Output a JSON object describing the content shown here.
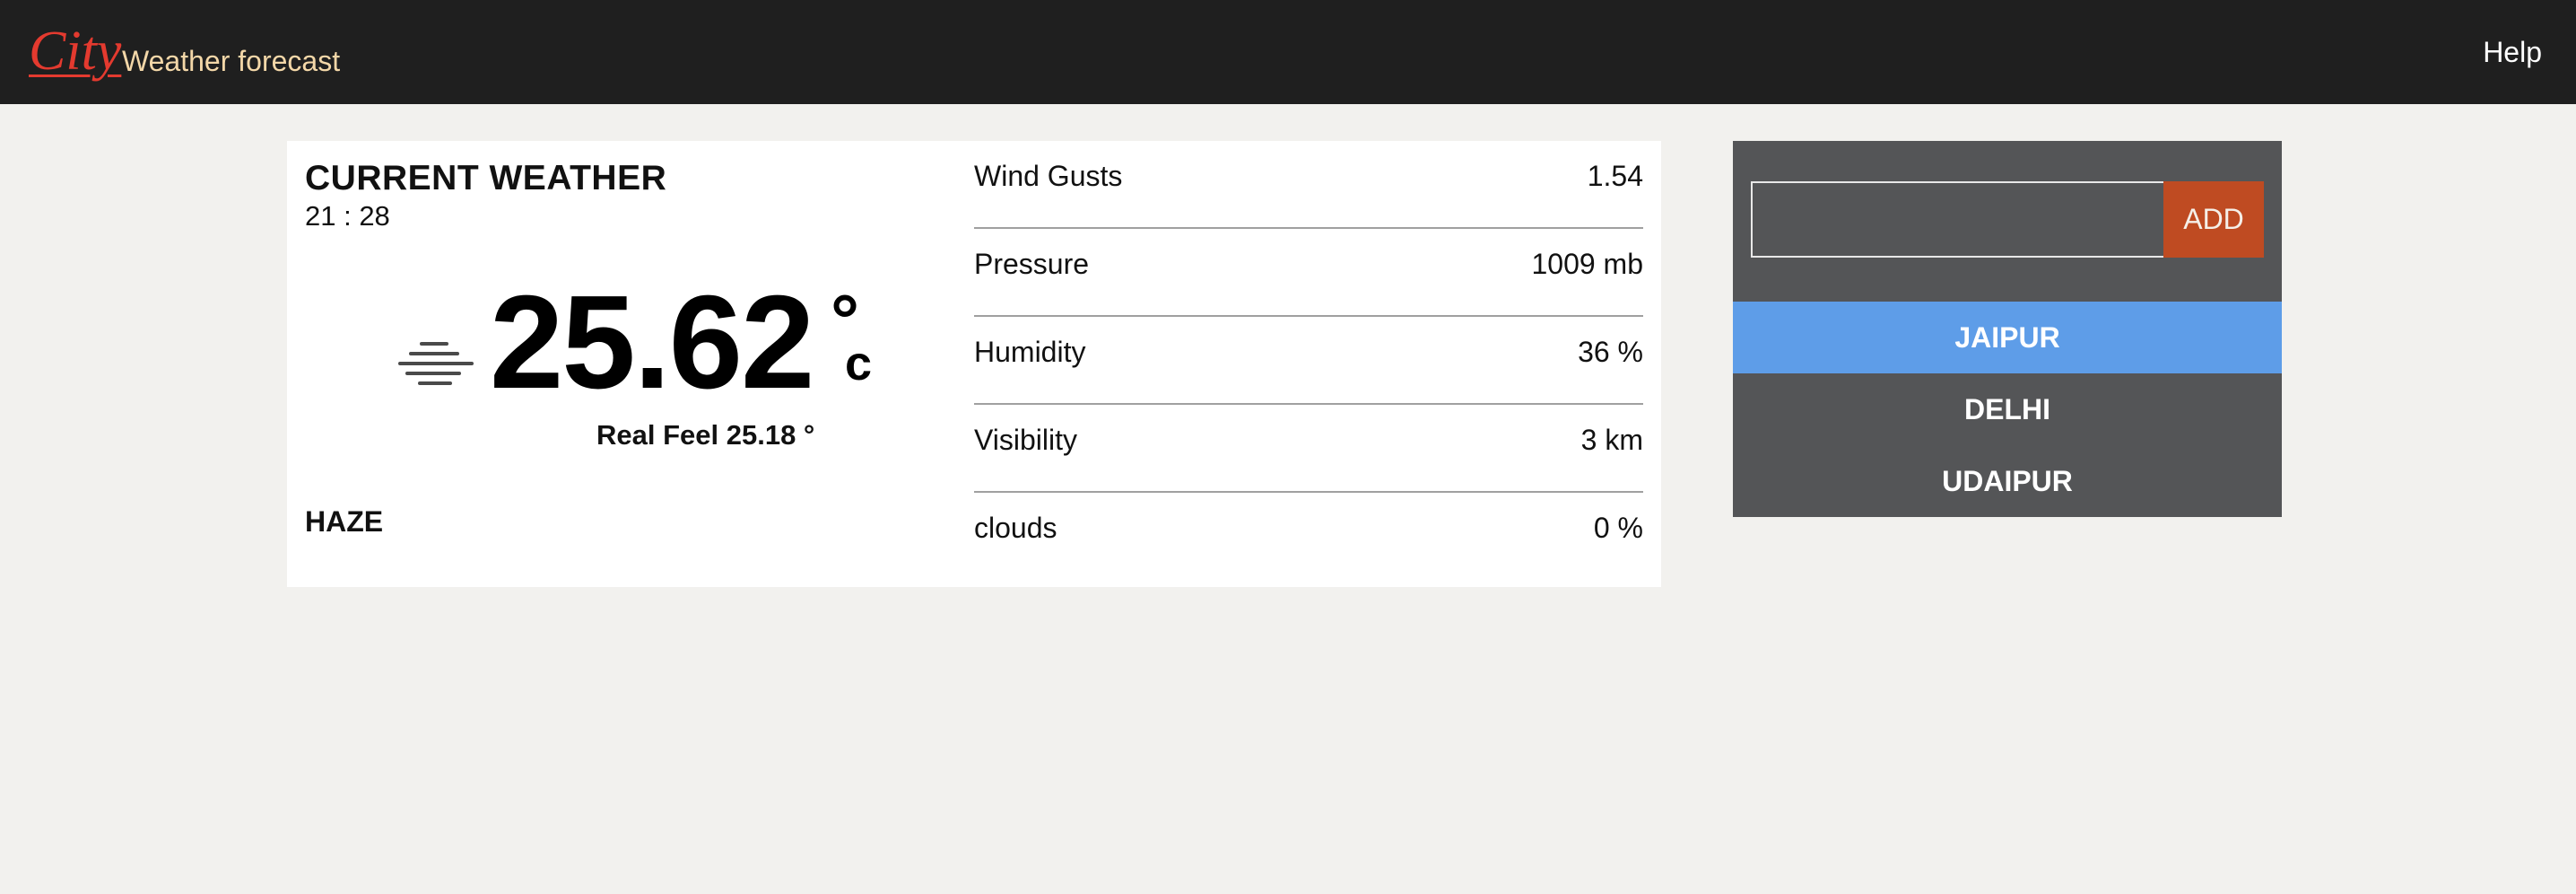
{
  "navbar": {
    "brand": "City",
    "subtitle": "Weather forecast",
    "help_label": "Help"
  },
  "weather": {
    "title": "CURRENT WEATHER",
    "time": "21 : 28",
    "temperature": "25.62",
    "degree_symbol": "°",
    "unit": "c",
    "real_feel": "Real Feel 25.18 °",
    "condition": "HAZE",
    "icon": "haze-icon",
    "details": [
      {
        "label": "Wind Gusts",
        "value": "1.54"
      },
      {
        "label": "Pressure",
        "value": "1009 mb"
      },
      {
        "label": "Humidity",
        "value": "36 %"
      },
      {
        "label": "Visibility",
        "value": "3 km"
      },
      {
        "label": "clouds",
        "value": "0 %"
      }
    ]
  },
  "cities": {
    "input_value": "",
    "add_label": "ADD",
    "list": [
      "JAIPUR",
      "DELHI",
      "UDAIPUR"
    ],
    "selected": "JAIPUR"
  },
  "colors": {
    "navbar_bg": "#1f1f1f",
    "brand": "#e43a2f",
    "subtitle": "#f3d7a8",
    "page_bg": "#f2f1ee",
    "panel_bg": "#545557",
    "add_button": "#bf4b22",
    "selected_city": "#5e9de8"
  }
}
